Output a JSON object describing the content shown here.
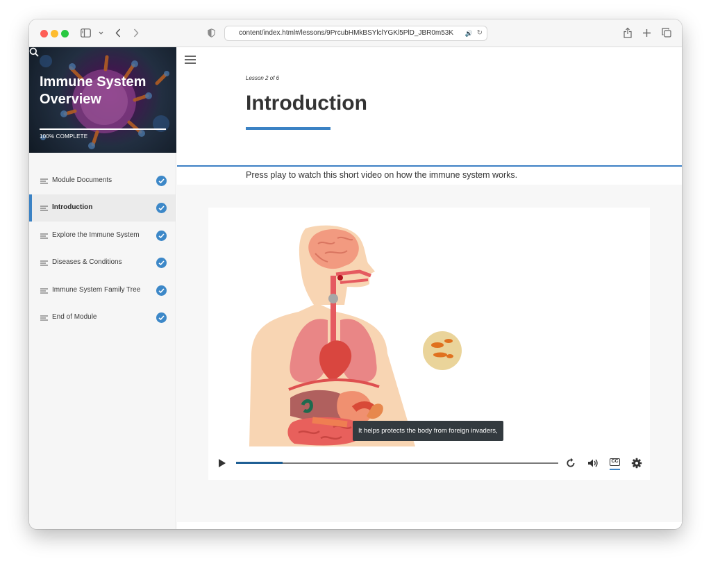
{
  "browser": {
    "address": "content/index.html#/lessons/9PrcubHMkBSYlclYGKl5PlD_JBR0m53K",
    "icons": [
      "sidebar-toggle-icon",
      "chevron-down-icon",
      "back-icon",
      "forward-icon",
      "shield-icon",
      "speaker-icon",
      "reload-icon",
      "share-icon",
      "new-tab-icon",
      "tabs-overview-icon"
    ]
  },
  "course": {
    "title": "Immune System Overview",
    "progress_text": "100% COMPLETE",
    "progress_fraction": 1.0
  },
  "nav": {
    "items": [
      {
        "label": "Module Documents",
        "completed": true,
        "active": false
      },
      {
        "label": "Introduction",
        "completed": true,
        "active": true
      },
      {
        "label": "Explore the Immune System",
        "completed": true,
        "active": false
      },
      {
        "label": "Diseases & Conditions",
        "completed": true,
        "active": false
      },
      {
        "label": "Immune System Family Tree",
        "completed": true,
        "active": false
      },
      {
        "label": "End of Module",
        "completed": true,
        "active": false
      }
    ]
  },
  "lesson": {
    "label": "Lesson 2 of 6",
    "title": "Introduction",
    "intro": "Press play to watch this short video on how the immune system works."
  },
  "video": {
    "caption": "It helps protects the body from foreign invaders,",
    "progress_fraction": 0.145,
    "cc_label": "CC",
    "controls": [
      "play-icon",
      "replay-icon",
      "volume-icon",
      "closed-captions-icon",
      "settings-icon"
    ]
  },
  "colors": {
    "accent": "#3b82c4",
    "check": "#3d88c8",
    "seek_fill": "#1f5f94",
    "caption_bg": "#333a3f"
  }
}
